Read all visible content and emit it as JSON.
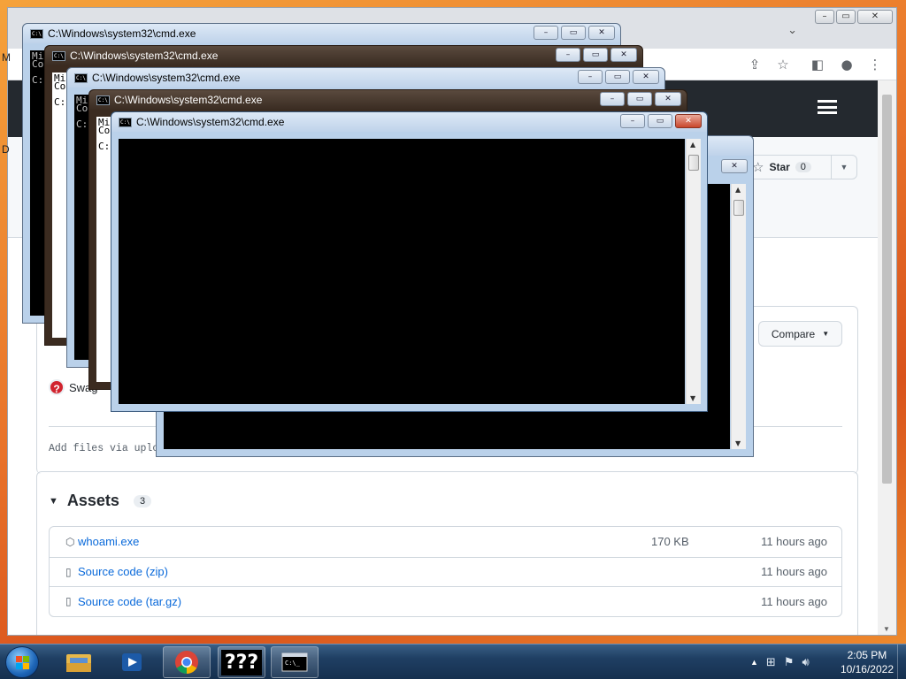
{
  "browser": {
    "star_label": "Star",
    "star_count": "0",
    "compare_label": "Compare",
    "swag_text": "Swag",
    "add_files_text": "Add files via uplo",
    "assets": {
      "title": "Assets",
      "count": "3",
      "rows": [
        {
          "name": "whoami.exe",
          "sub": "",
          "size": "170 KB",
          "time": "11 hours ago"
        },
        {
          "name": "Source code",
          "sub": "(zip)",
          "size": "",
          "time": "11 hours ago"
        },
        {
          "name": "Source code",
          "sub": "(tar.gz)",
          "size": "",
          "time": "11 hours ago"
        }
      ]
    },
    "left_edge_letters": [
      "M",
      "D"
    ]
  },
  "cmd_windows": [
    {
      "title": "C:\\Windows\\system32\\cmd.exe",
      "lines": [
        "Mi",
        "Co",
        "",
        "C:"
      ]
    },
    {
      "title": "C:\\Windows\\system32\\cmd.exe",
      "lines": [
        "Mi",
        "Co",
        "",
        "C:"
      ]
    },
    {
      "title": "C:\\Windows\\system32\\cmd.exe",
      "lines": [
        "Mi",
        "Co",
        "",
        "C:"
      ]
    },
    {
      "title": "C:\\Windows\\system32\\cmd.exe",
      "lines": [
        "Mi",
        "Co",
        "",
        "C:"
      ]
    },
    {
      "title": "C:\\Windows\\system32\\cmd.exe",
      "lines": []
    }
  ],
  "taskbar": {
    "items": [
      "explorer",
      "media-player",
      "chrome",
      "unknown-app",
      "cmd"
    ],
    "unknown_app_label": "???",
    "clock_time": "2:05 PM",
    "clock_date": "10/16/2022"
  },
  "colors": {
    "github_header": "#24292f",
    "link": "#0969da",
    "taskbar": "#1f3f63"
  }
}
